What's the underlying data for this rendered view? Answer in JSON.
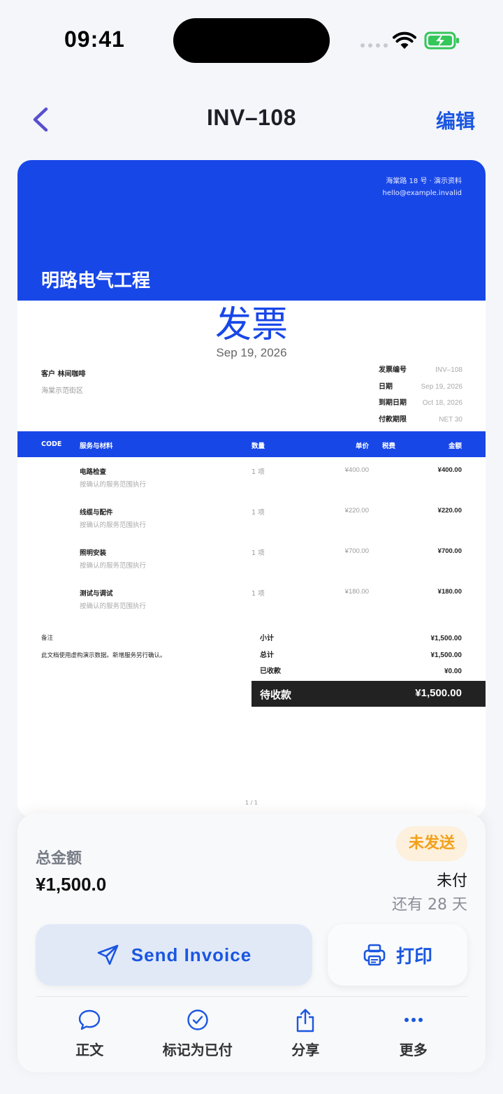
{
  "status_bar": {
    "time": "09:41"
  },
  "nav": {
    "title": "INV–108",
    "edit_label": "编辑"
  },
  "invoice": {
    "address_line": "海棠路 18 号 · 演示资料",
    "email": "hello@example.invalid",
    "company_name": "明路电气工程",
    "doc_title": "发票",
    "doc_date": "Sep 19, 2026",
    "client_label": "客户",
    "client_name": "林间咖啡",
    "client_address": "海棠示范街区",
    "meta": [
      {
        "label": "发票编号",
        "value": "INV–108"
      },
      {
        "label": "日期",
        "value": "Sep 19, 2026"
      },
      {
        "label": "到期日期",
        "value": "Oct 18, 2026"
      },
      {
        "label": "付款期限",
        "value": "NET 30"
      }
    ],
    "columns": {
      "code": "CODE",
      "item": "服务与材料",
      "qty": "数量",
      "price": "单价",
      "tax": "税费",
      "amount": "金额"
    },
    "items": [
      {
        "name": "电路检查",
        "desc": "按确认的服务范围执行",
        "qty": "1 项",
        "price": "¥400.00",
        "amount": "¥400.00"
      },
      {
        "name": "线缆与配件",
        "desc": "按确认的服务范围执行",
        "qty": "1 项",
        "price": "¥220.00",
        "amount": "¥220.00"
      },
      {
        "name": "照明安装",
        "desc": "按确认的服务范围执行",
        "qty": "1 项",
        "price": "¥700.00",
        "amount": "¥700.00"
      },
      {
        "name": "测试与调试",
        "desc": "按确认的服务范围执行",
        "qty": "1 项",
        "price": "¥180.00",
        "amount": "¥180.00"
      }
    ],
    "notes_label": "备注",
    "notes_text": "此文档使用虚构演示数据。新增服务另行确认。",
    "totals": [
      {
        "label": "小计",
        "value": "¥1,500.00"
      },
      {
        "label": "总计",
        "value": "¥1,500.00"
      },
      {
        "label": "已收款",
        "value": "¥0.00"
      }
    ],
    "balance_label": "待收款",
    "balance_value": "¥1,500.00",
    "page_indicator": "1 / 1"
  },
  "summary": {
    "total_label": "总金额",
    "total_value": "¥1,500.0",
    "status_badge": "未发送",
    "payment_status": "未付",
    "days_left": "还有 28 天",
    "send_label": "Send Invoice",
    "print_label": "打印"
  },
  "actions": [
    {
      "label": "正文",
      "icon": "message-bubble-icon"
    },
    {
      "label": "标记为已付",
      "icon": "check-circle-icon"
    },
    {
      "label": "分享",
      "icon": "share-icon"
    },
    {
      "label": "更多",
      "icon": "more-icon"
    }
  ],
  "colors": {
    "accent": "#1a56e0",
    "invoice_brand": "#1847e8",
    "badge_bg": "#fdf0dc",
    "badge_text": "#f2a01a",
    "battery_green": "#34c759"
  }
}
